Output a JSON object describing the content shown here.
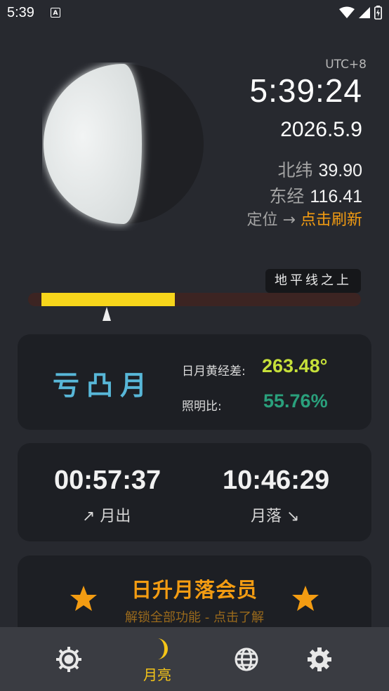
{
  "status_bar": {
    "time": "5:39",
    "a_icon": "A"
  },
  "header": {
    "timezone": "UTC+8",
    "clock": "5:39:24",
    "date": "2026.5.9",
    "lat_label": "北纬",
    "lat_value": "39.90",
    "lon_label": "东经",
    "lon_value": "116.41",
    "locate_label": "定位 →",
    "refresh_label": "点击刷新"
  },
  "horizon": {
    "badge": "地平线之上",
    "fill_fraction": 0.4,
    "colors": {
      "fill": "#f7d51b",
      "track": "#3c2422"
    }
  },
  "phase_card": {
    "phase_name": "亏凸月",
    "elongation_label": "日月黄经差:",
    "elongation_value": "263.48°",
    "illumination_label": "照明比:",
    "illumination_value": "55.76%",
    "illumination_fraction": 0.5576,
    "colors": {
      "name": "#58b7d8",
      "elongation": "#c6e03a",
      "illumination": "#2aa07c"
    }
  },
  "rise_set_card": {
    "moonrise_time": "00:57:37",
    "moonrise_label": "↗ 月出",
    "moonset_time": "10:46:29",
    "moonset_label": "月落 ↘"
  },
  "member_card": {
    "title": "日升月落会员",
    "subtitle": "解锁全部功能 - 点击了解",
    "icon_left": "star-icon",
    "icon_right": "star-icon",
    "accent": "#f39c12"
  },
  "bottom_nav": {
    "items": [
      {
        "icon": "sun-icon",
        "label": ""
      },
      {
        "icon": "moon-icon",
        "label": "月亮",
        "active": true
      },
      {
        "icon": "globe-icon",
        "label": ""
      },
      {
        "icon": "gear-icon",
        "label": ""
      }
    ],
    "active_color": "#f5c518"
  }
}
